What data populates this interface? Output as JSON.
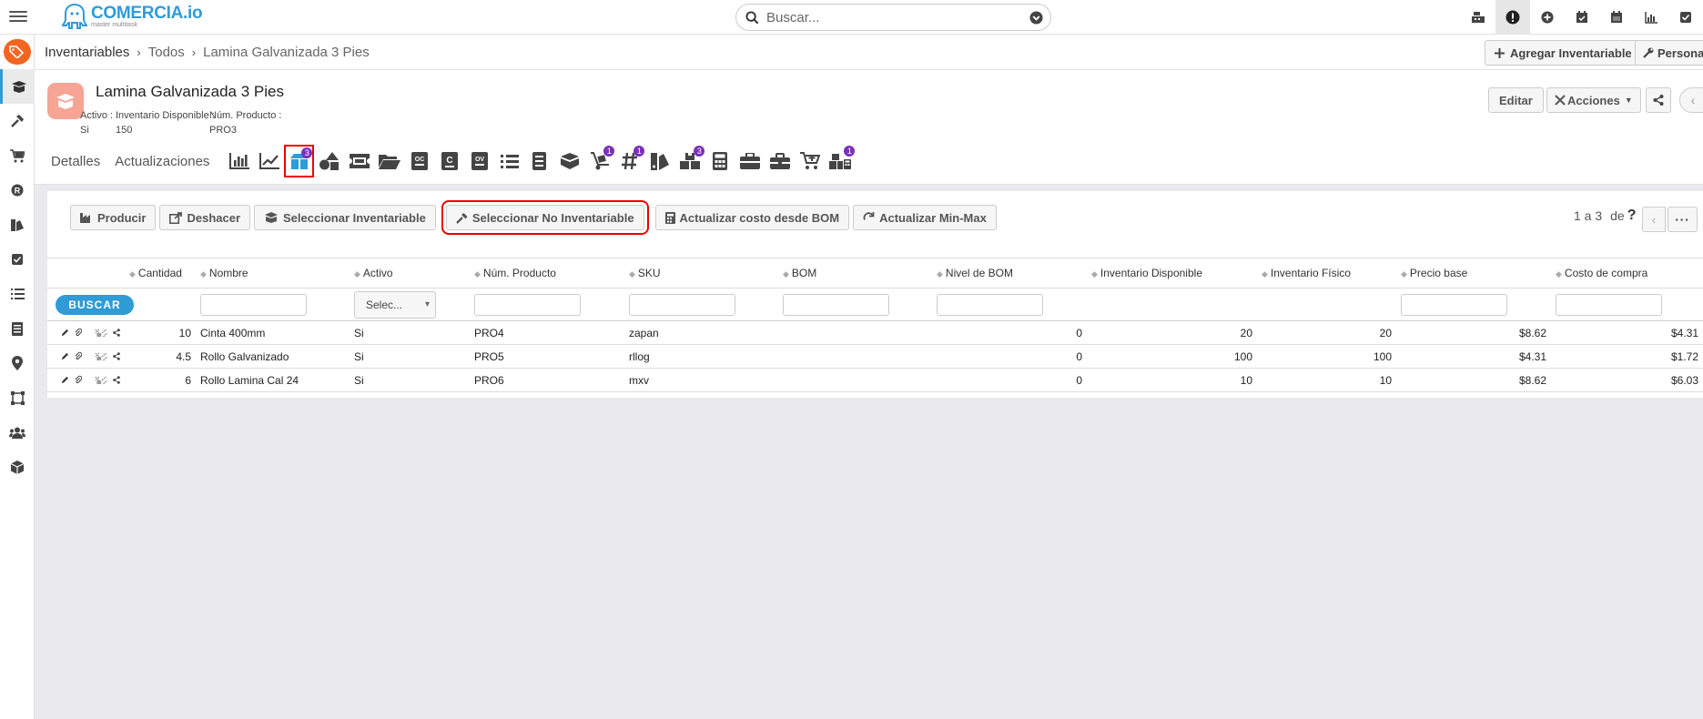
{
  "header": {
    "logo_name": "COMERCIA.io",
    "logo_sub": "master multitask",
    "search_placeholder": "Buscar..."
  },
  "breadcrumb": {
    "items": [
      "Inventariables",
      "Todos",
      "Lamina Galvanizada 3 Pies"
    ],
    "add_label": "Agregar Inventariable",
    "personalize_label": "Persona"
  },
  "product": {
    "title": "Lamina Galvanizada 3 Pies",
    "meta": [
      {
        "label": "Activo :",
        "value": "Si"
      },
      {
        "label": "Inventario Disponible :",
        "value": "150"
      },
      {
        "label": "Núm. Producto :",
        "value": "PRO3"
      }
    ],
    "edit_label": "Editar",
    "actions_label": "Acciones"
  },
  "tabs": {
    "details": "Detalles",
    "updates": "Actualizaciones",
    "badges": {
      "bom": "3",
      "cart_hand": "1",
      "hash": "1",
      "boxes": "3",
      "boxes_calc": "1"
    }
  },
  "toolbar": {
    "producir": "Producir",
    "deshacer": "Deshacer",
    "sel_inv": "Seleccionar Inventariable",
    "sel_no_inv": "Seleccionar No Inventariable",
    "act_costo": "Actualizar costo desde BOM",
    "act_minmax": "Actualizar Min-Max"
  },
  "pager": {
    "range": "1 a 3",
    "of": "de",
    "help": "?"
  },
  "table": {
    "columns": [
      "Cantidad",
      "Nombre",
      "Activo",
      "Núm. Producto",
      "SKU",
      "BOM",
      "Nivel de BOM",
      "Inventario Disponible",
      "Inventario Físico",
      "Precio base",
      "Costo de compra"
    ],
    "buscar_label": "BUSCAR",
    "activo_select": "Selec...",
    "rows": [
      {
        "cantidad": "10",
        "nombre": "Cinta 400mm",
        "activo": "Si",
        "num": "PRO4",
        "sku": "zapan",
        "bom": "",
        "nivel": "0",
        "disp": "20",
        "fisico": "20",
        "precio": "$8.62",
        "costo": "$4.31"
      },
      {
        "cantidad": "4.5",
        "nombre": "Rollo Galvanizado",
        "activo": "Si",
        "num": "PRO5",
        "sku": "rllog",
        "bom": "",
        "nivel": "0",
        "disp": "100",
        "fisico": "100",
        "precio": "$4.31",
        "costo": "$1.72"
      },
      {
        "cantidad": "6",
        "nombre": "Rollo Lamina Cal 24",
        "activo": "Si",
        "num": "PRO6",
        "sku": "mxv",
        "bom": "",
        "nivel": "0",
        "disp": "10",
        "fisico": "10",
        "precio": "$8.62",
        "costo": "$6.03"
      }
    ]
  },
  "colors": {
    "accent": "#2f9bd7",
    "brand_orange": "#f26522",
    "badge": "#7b2fbd",
    "highlight": "#ee0000"
  }
}
